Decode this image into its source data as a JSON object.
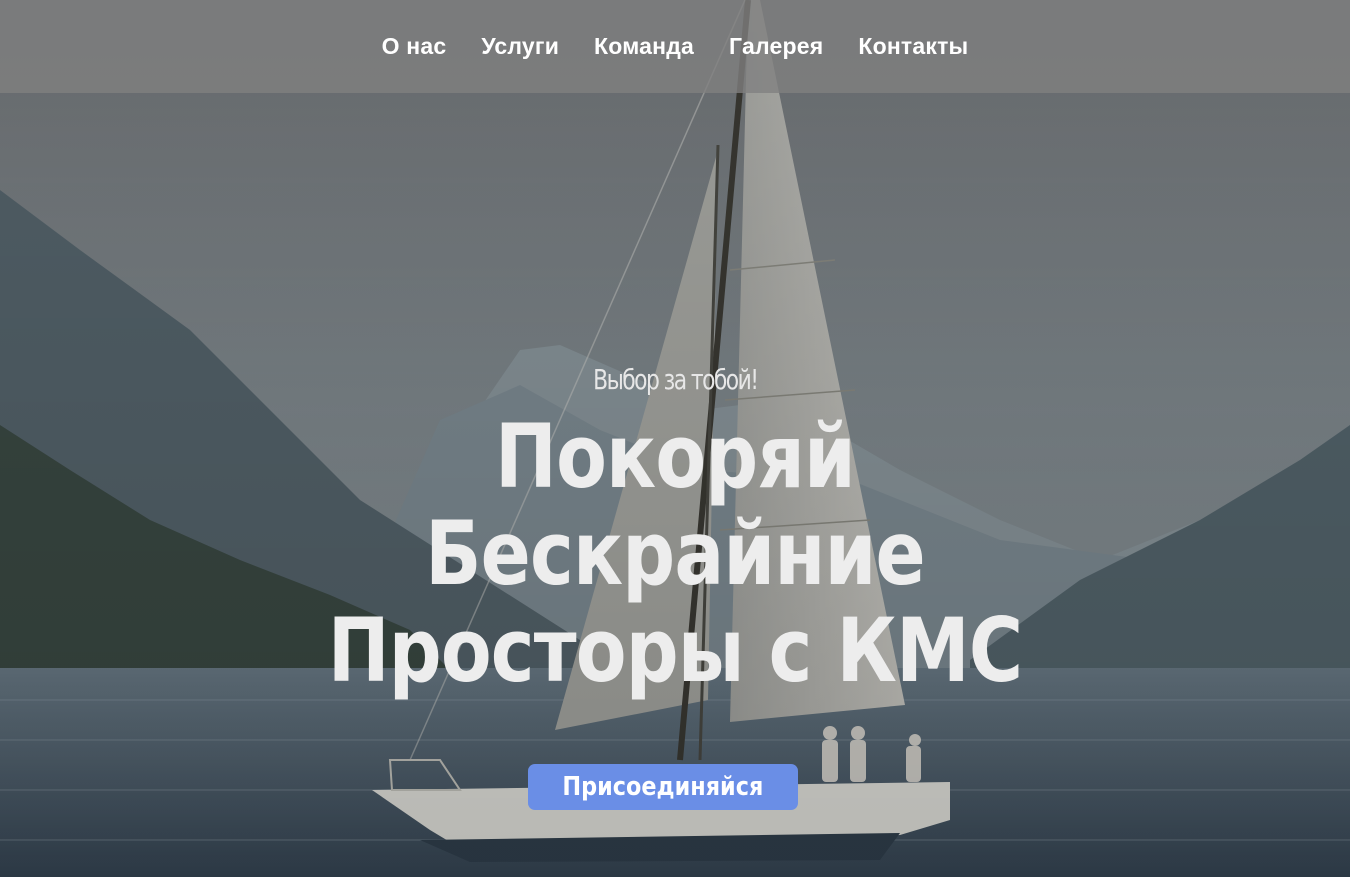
{
  "nav": {
    "items": [
      {
        "label": "О нас"
      },
      {
        "label": "Услуги"
      },
      {
        "label": "Команда"
      },
      {
        "label": "Галерея"
      },
      {
        "label": "Контакты"
      }
    ]
  },
  "hero": {
    "subtitle": "Выбор за тобой!",
    "title_lines": [
      "Покоряй",
      "Бескрайние",
      "Просторы с КМС"
    ],
    "cta_label": "Присоединяйся",
    "background": "sailboat-on-mountain-lake-photo"
  },
  "colors": {
    "nav_bg": "#808080",
    "cta_bg": "#6a8ee6",
    "text": "#ffffff"
  }
}
